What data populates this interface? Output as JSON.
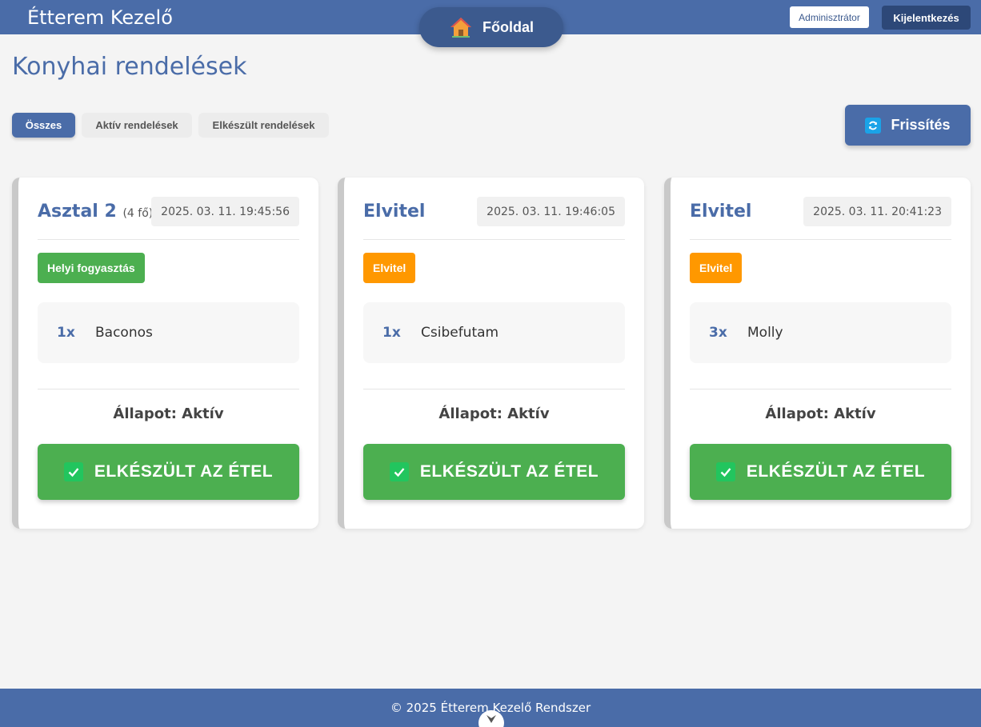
{
  "header": {
    "brand": "Étterem Kezelő",
    "home_label": "Főoldal",
    "home_icon": "house-icon",
    "admin_label": "Adminisztrátor",
    "logout_label": "Kijelentkezés"
  },
  "page": {
    "title": "Konyhai rendelések"
  },
  "filters": [
    {
      "label": "Összes",
      "active": true
    },
    {
      "label": "Aktív rendelések",
      "active": false
    },
    {
      "label": "Elkészült rendelések",
      "active": false
    }
  ],
  "refresh": {
    "label": "Frissítés",
    "icon": "refresh-icon"
  },
  "orders": [
    {
      "title": "Asztal 2",
      "guests": "(4 fő)",
      "timestamp": "2025. 03. 11. 19:45:56",
      "type": "Helyi fogyasztás",
      "type_color": "#4caf50",
      "items": [
        {
          "qty": "1x",
          "name": "Baconos"
        }
      ],
      "status": "Állapot: Aktív",
      "action": "ELKÉSZÜLT AZ ÉTEL"
    },
    {
      "title": "Elvitel",
      "guests": "",
      "timestamp": "2025. 03. 11. 19:46:05",
      "type": "Elvitel",
      "type_color": "#ff9800",
      "items": [
        {
          "qty": "1x",
          "name": "Csibefutam"
        }
      ],
      "status": "Állapot: Aktív",
      "action": "ELKÉSZÜLT AZ ÉTEL"
    },
    {
      "title": "Elvitel",
      "guests": "",
      "timestamp": "2025. 03. 11. 20:41:23",
      "type": "Elvitel",
      "type_color": "#ff9800",
      "items": [
        {
          "qty": "3x",
          "name": "Molly"
        }
      ],
      "status": "Állapot: Aktív",
      "action": "ELKÉSZÜLT AZ ÉTEL"
    }
  ],
  "footer": {
    "text": "© 2025 Étterem Kezelő Rendszer"
  },
  "colors": {
    "primary": "#4a6ca8",
    "success": "#4caf50",
    "warning": "#ff9800"
  }
}
